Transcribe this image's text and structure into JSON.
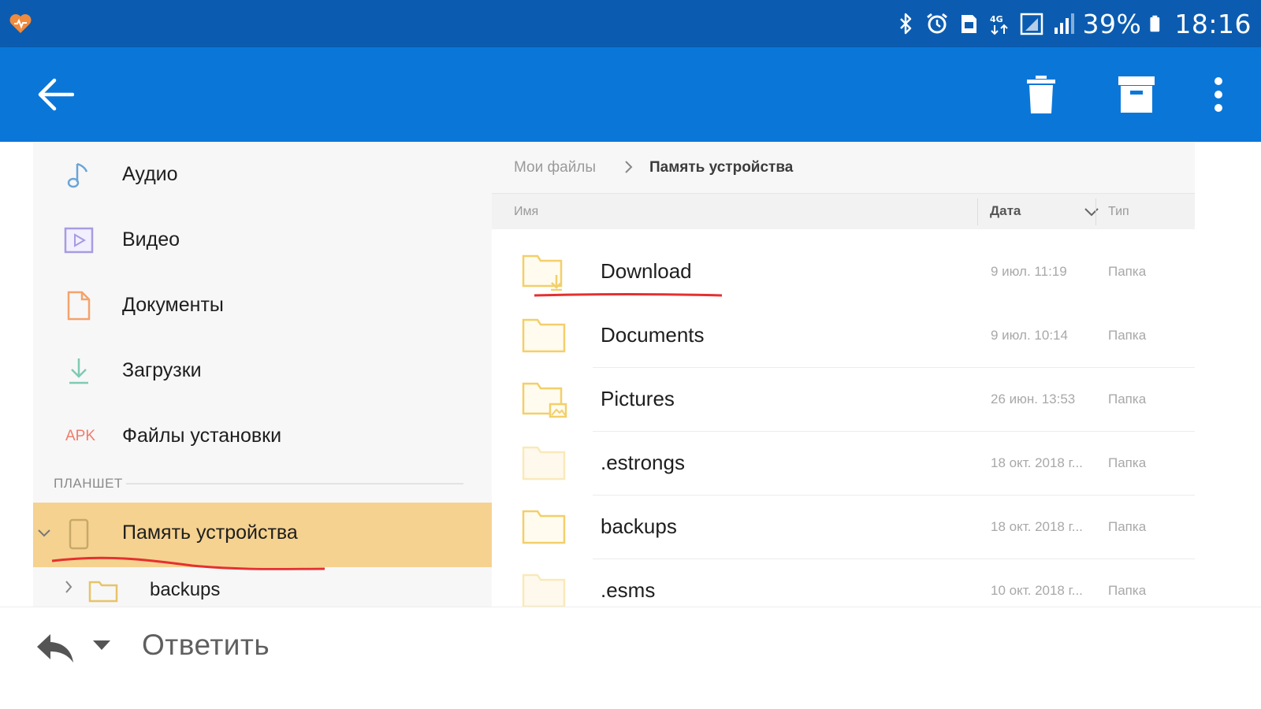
{
  "status_bar": {
    "battery_percent": "39%",
    "time": "18:16",
    "network_type": "4G",
    "icons": [
      "app-heart-icon",
      "bluetooth-icon",
      "alarm-icon",
      "sd-card-icon",
      "network-4g-icon",
      "signal-icon",
      "battery-icon"
    ]
  },
  "app_bar": {
    "icons": [
      "back-arrow-icon",
      "trash-icon",
      "archive-icon",
      "more-vert-icon"
    ]
  },
  "sidebar": {
    "items": [
      {
        "label": "Аудио",
        "icon": "music-note-icon"
      },
      {
        "label": "Видео",
        "icon": "video-icon"
      },
      {
        "label": "Документы",
        "icon": "document-icon"
      },
      {
        "label": "Загрузки",
        "icon": "download-icon"
      },
      {
        "label": "Файлы установки",
        "icon": "apk-icon",
        "icon_text": "APK"
      }
    ],
    "section_header": "ПЛАНШЕТ",
    "device_item": {
      "label": "Память устройства",
      "icon": "phone-storage-icon",
      "selected": true
    },
    "sub_item": {
      "label": "backups",
      "icon": "folder-icon"
    }
  },
  "file_browser": {
    "breadcrumb": {
      "root": "Мои файлы",
      "current": "Память устройства"
    },
    "columns": {
      "name": "Имя",
      "date": "Дата",
      "type": "Тип"
    },
    "rows": [
      {
        "name": "Download",
        "date": "9 июл. 11:19",
        "type": "Папка",
        "icon": "folder-download-icon"
      },
      {
        "name": "Documents",
        "date": "9 июл. 10:14",
        "type": "Папка",
        "icon": "folder-icon"
      },
      {
        "name": "Pictures",
        "date": "26 июн. 13:53",
        "type": "Папка",
        "icon": "folder-image-icon"
      },
      {
        "name": ".estrongs",
        "date": "18 окт. 2018 г...",
        "type": "Папка",
        "icon": "folder-hidden-icon"
      },
      {
        "name": "backups",
        "date": "18 окт. 2018 г...",
        "type": "Папка",
        "icon": "folder-icon"
      },
      {
        "name": ".esms",
        "date": "10 окт. 2018 г...",
        "type": "Папка",
        "icon": "folder-hidden-icon"
      }
    ]
  },
  "reply_bar": {
    "label": "Ответить",
    "icons": [
      "reply-arrow-icon",
      "dropdown-triangle-icon"
    ]
  },
  "colors": {
    "status_bar": "#0b5cb0",
    "app_bar": "#0a77d8",
    "selected_item": "#f5d290",
    "folder": "#f3cf6a",
    "annotation_red": "#e53030",
    "apk_label": "#f07c6c"
  }
}
